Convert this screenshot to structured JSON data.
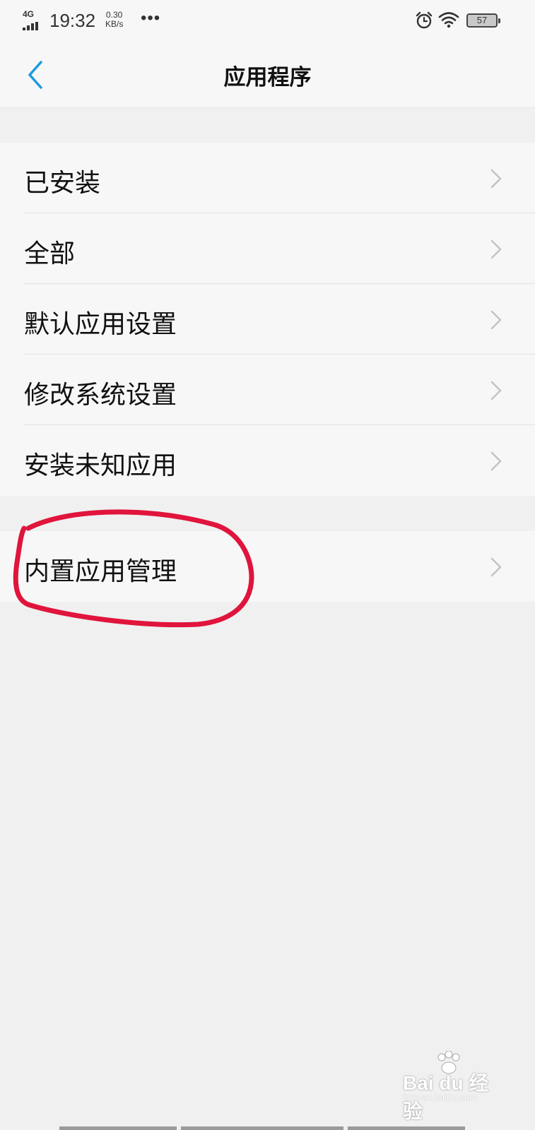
{
  "status_bar": {
    "network": "4G",
    "time": "19:32",
    "speed_value": "0.30",
    "speed_unit": "KB/s",
    "more": "•••",
    "battery_level": "57",
    "icons": [
      "signal-icon",
      "alarm-icon",
      "wifi-icon",
      "battery-icon"
    ]
  },
  "header": {
    "title": "应用程序",
    "back_icon": "chevron-left-icon",
    "accent_color": "#1a9be0"
  },
  "groups": [
    {
      "items": [
        {
          "label": "已安装"
        },
        {
          "label": "全部"
        },
        {
          "label": "默认应用设置"
        },
        {
          "label": "修改系统设置"
        },
        {
          "label": "安装未知应用"
        }
      ]
    },
    {
      "items": [
        {
          "label": "内置应用管理"
        }
      ]
    }
  ],
  "annotation": {
    "color": "#e0143c",
    "target": "内置应用管理"
  },
  "watermark": {
    "text": "Bai du 经验",
    "sub": "jingyan.baidu.com"
  }
}
